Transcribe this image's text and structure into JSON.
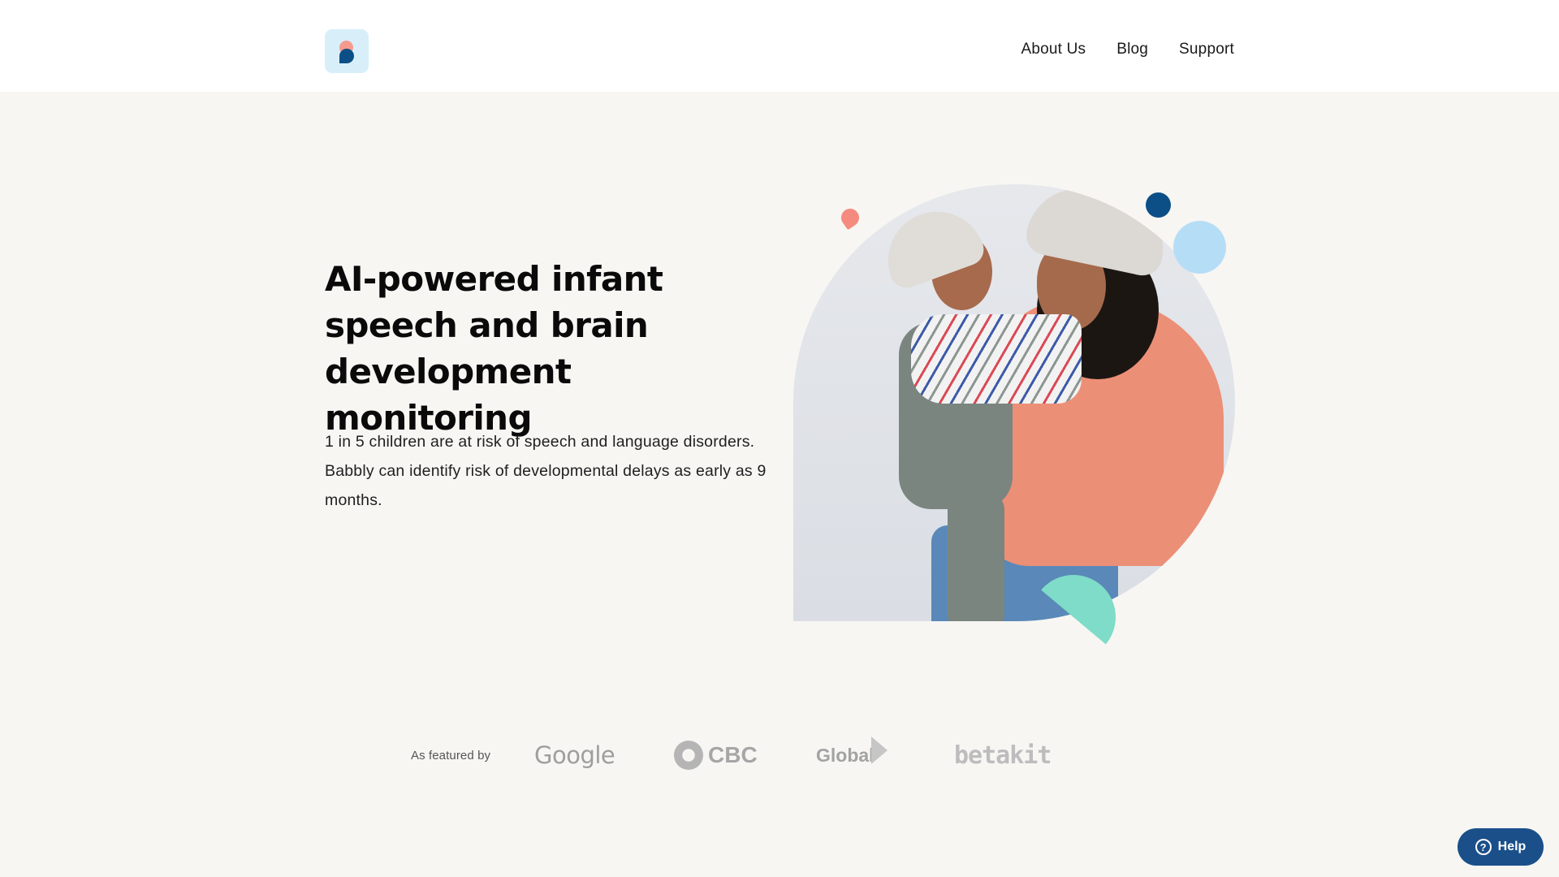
{
  "header": {
    "logo_alt": "Babbly",
    "nav": [
      {
        "label": "About Us"
      },
      {
        "label": "Blog"
      },
      {
        "label": "Support"
      }
    ]
  },
  "hero": {
    "title": "AI-powered infant speech and brain development monitoring",
    "description": "1 in 5 children are at risk of speech and language disorders. Babbly can identify risk of developmental delays as early as 9 months.",
    "image_alt": "Smiling mother holding laughing baby, both in knit beanies"
  },
  "featured": {
    "label": "As featured by",
    "brands": [
      {
        "name": "Google"
      },
      {
        "name": "CBC"
      },
      {
        "name": "Global"
      },
      {
        "name": "betakit"
      }
    ]
  },
  "help_button": {
    "label": "Help",
    "icon": "?"
  },
  "colors": {
    "brand_navy": "#0c4f87",
    "brand_coral": "#f59a8d",
    "brand_sky": "#b6ddf6",
    "brand_mint": "#7edcc8",
    "help_button": "#1a4f8a",
    "page_bg": "#f7f6f3"
  }
}
